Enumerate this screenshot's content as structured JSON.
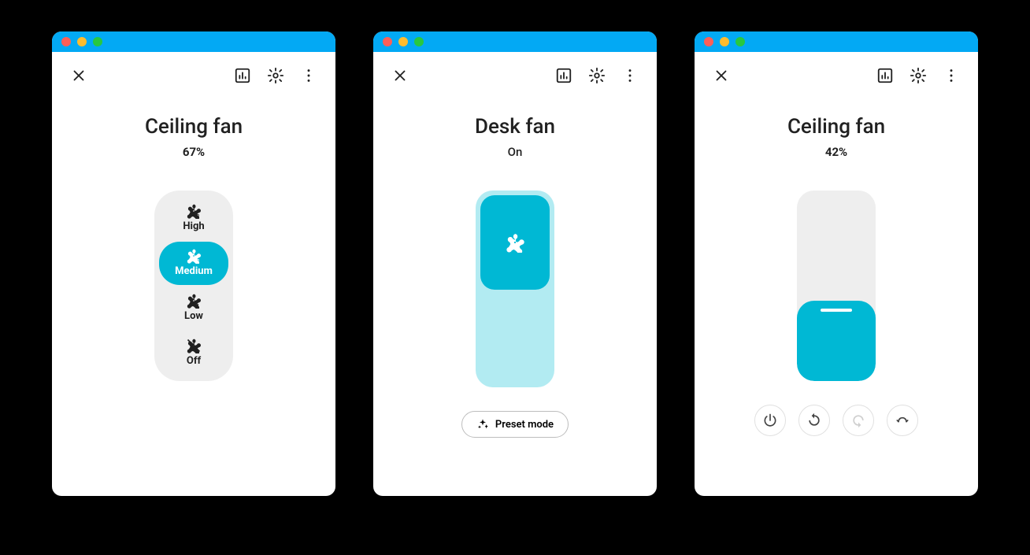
{
  "panels": [
    {
      "title": "Ceiling fan",
      "status": "67%",
      "speeds": [
        {
          "label": "High"
        },
        {
          "label": "Medium"
        },
        {
          "label": "Low"
        },
        {
          "label": "Off"
        }
      ],
      "active_speed": 1
    },
    {
      "title": "Desk fan",
      "status": "On",
      "preset_label": "Preset mode"
    },
    {
      "title": "Ceiling fan",
      "status": "42%",
      "fill_percent": 42
    }
  ]
}
